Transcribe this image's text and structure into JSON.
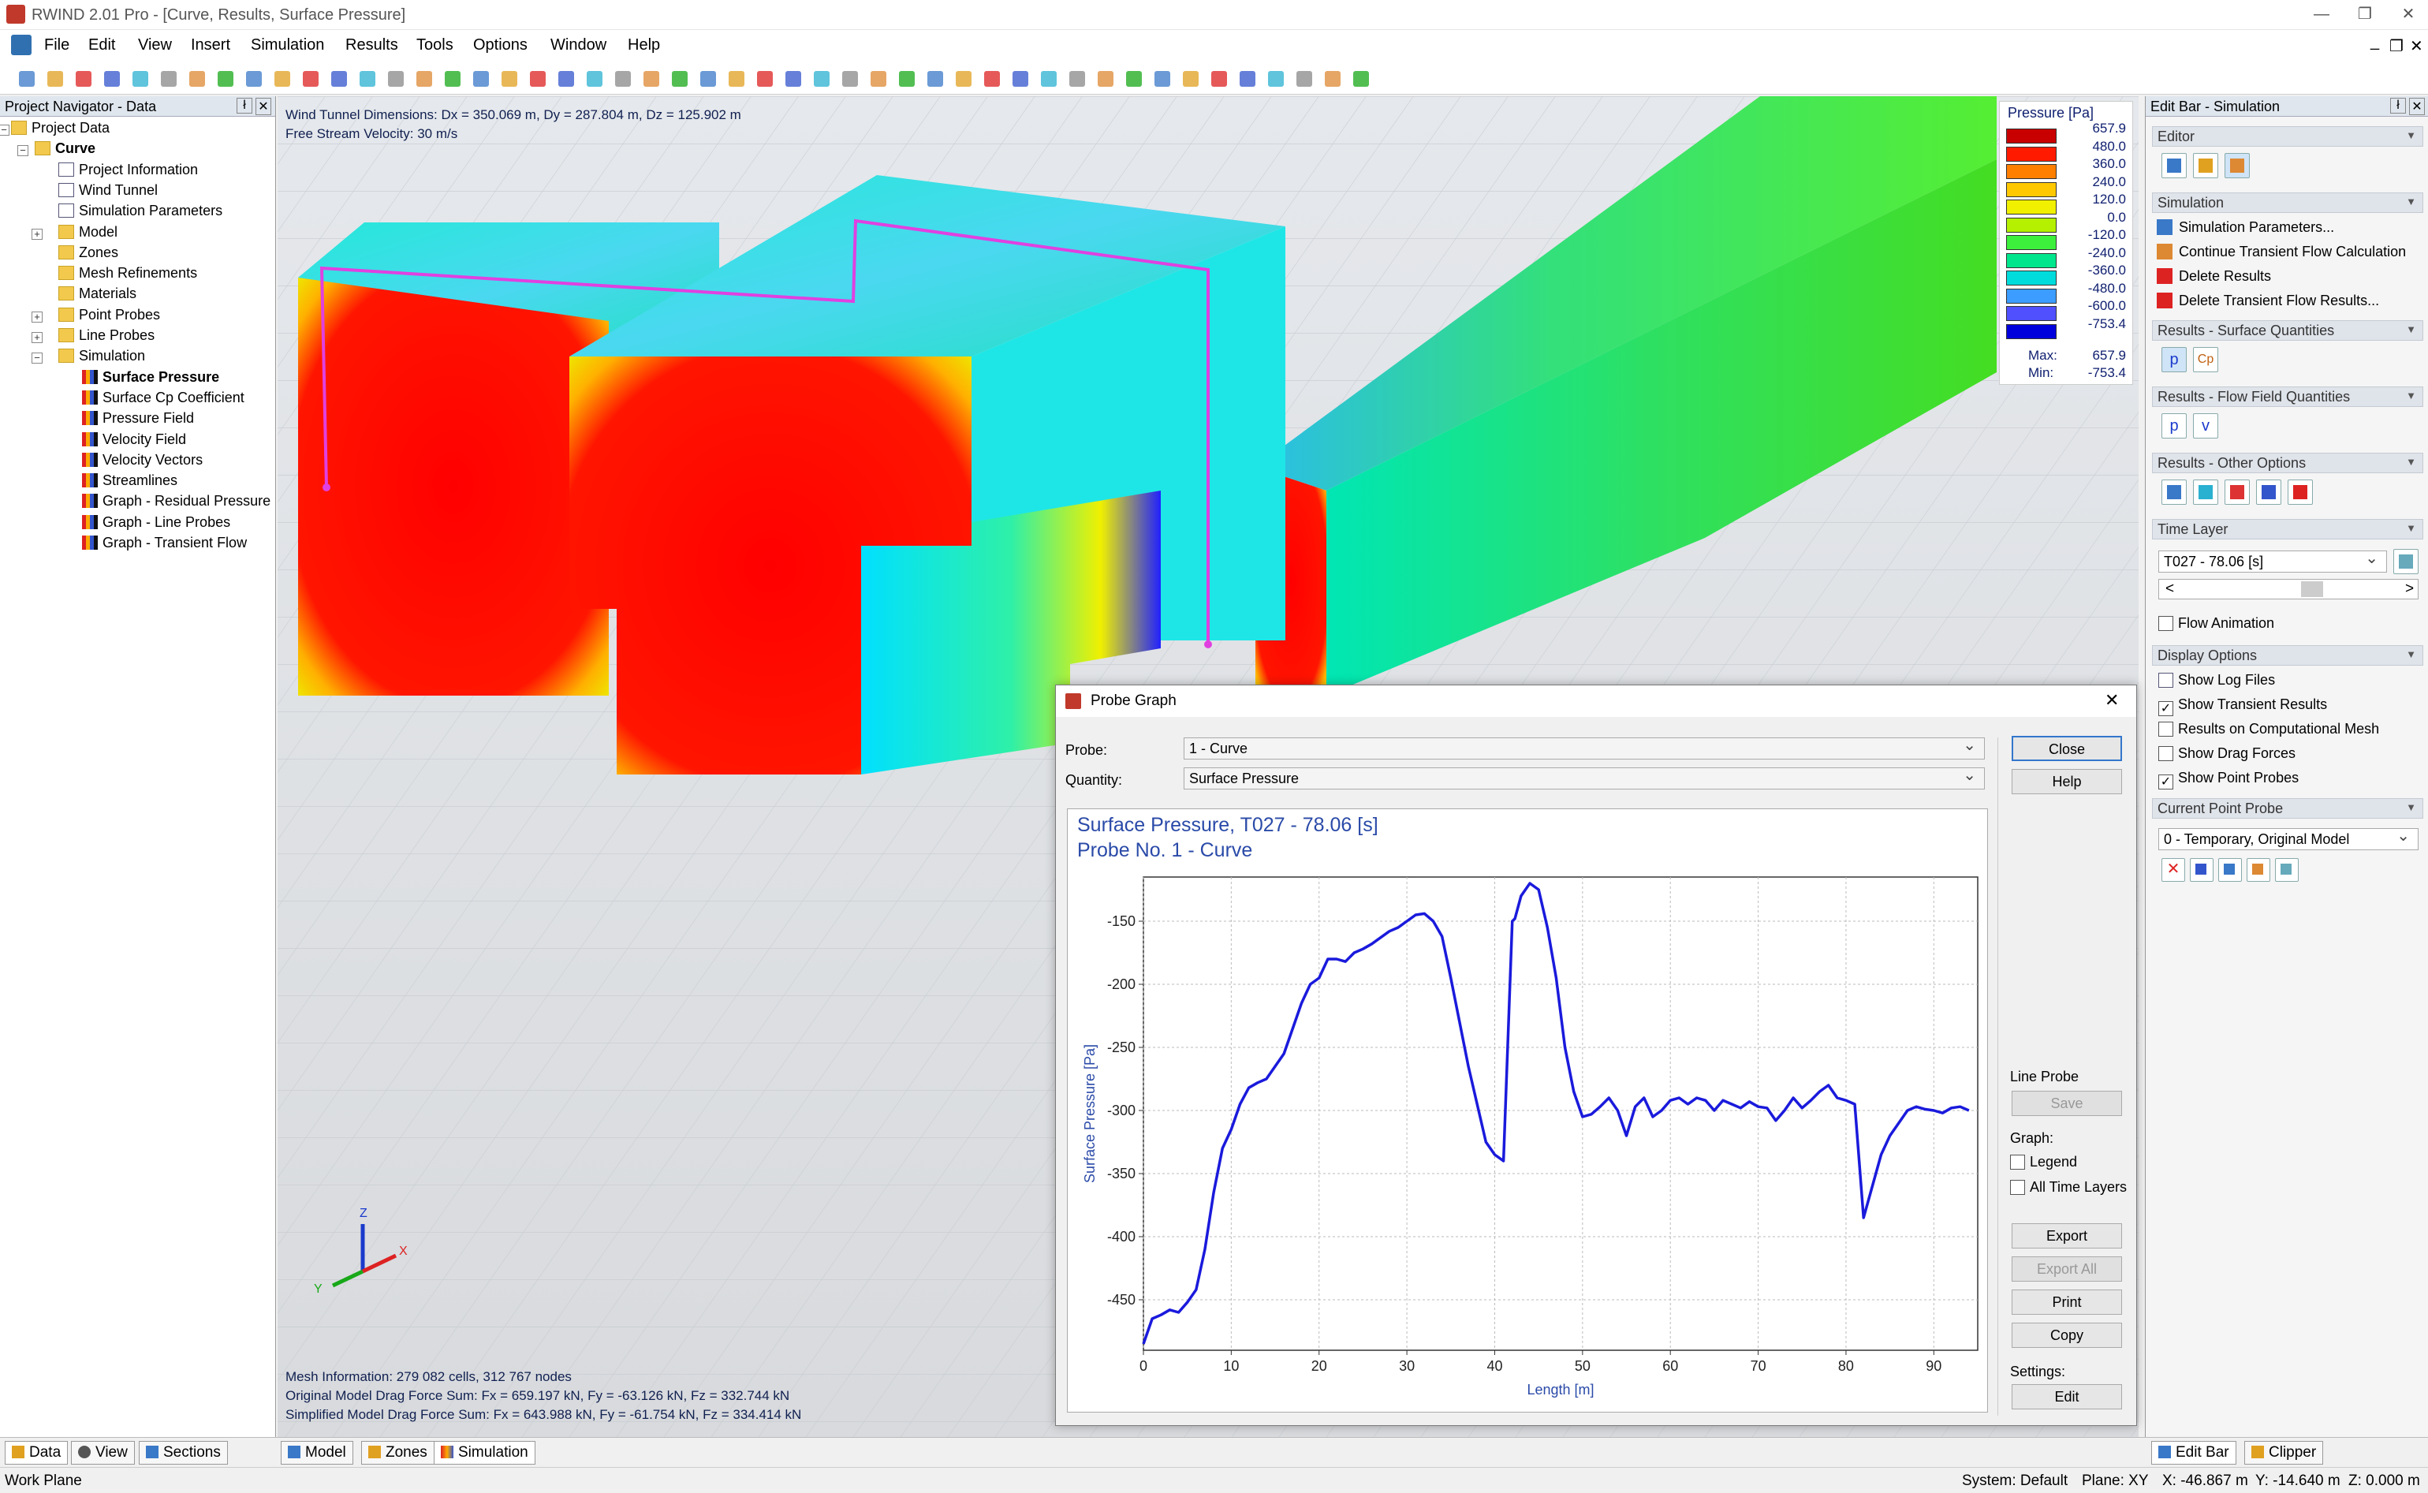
{
  "window": {
    "title": "RWIND 2.01 Pro - [Curve, Results, Surface Pressure]",
    "minimize": "—",
    "restore": "❐",
    "close": "✕",
    "inner_min": "_",
    "inner_restore": "❐",
    "inner_close": "✕"
  },
  "menu": [
    "File",
    "Edit",
    "View",
    "Insert",
    "Simulation",
    "Results",
    "Tools",
    "Options",
    "Window",
    "Help"
  ],
  "navigator": {
    "title": "Project Navigator - Data",
    "pin": "ł",
    "close": "✕",
    "items": [
      {
        "label": "Project Data",
        "icon": "folder"
      },
      {
        "label": "Curve",
        "icon": "folder",
        "bold": true
      },
      {
        "label": "Project Information",
        "icon": "doc"
      },
      {
        "label": "Wind Tunnel",
        "icon": "doc"
      },
      {
        "label": "Simulation Parameters",
        "icon": "doc"
      },
      {
        "label": "Model",
        "icon": "folder"
      },
      {
        "label": "Zones",
        "icon": "folder"
      },
      {
        "label": "Mesh Refinements",
        "icon": "folder"
      },
      {
        "label": "Materials",
        "icon": "folder"
      },
      {
        "label": "Point Probes",
        "icon": "folder"
      },
      {
        "label": "Line Probes",
        "icon": "folder"
      },
      {
        "label": "Simulation",
        "icon": "folder"
      },
      {
        "label": "Surface Pressure",
        "icon": "result",
        "bold": true
      },
      {
        "label": "Surface Cp Coefficient",
        "icon": "result"
      },
      {
        "label": "Pressure Field",
        "icon": "result"
      },
      {
        "label": "Velocity Field",
        "icon": "result"
      },
      {
        "label": "Velocity Vectors",
        "icon": "result"
      },
      {
        "label": "Streamlines",
        "icon": "result"
      },
      {
        "label": "Graph - Residual Pressure",
        "icon": "result"
      },
      {
        "label": "Graph - Line Probes",
        "icon": "result"
      },
      {
        "label": "Graph - Transient Flow",
        "icon": "result"
      }
    ],
    "tabs": [
      "Data",
      "View",
      "Sections"
    ]
  },
  "viewport": {
    "info1": "Wind Tunnel Dimensions: Dx = 350.069 m, Dy = 287.804 m, Dz = 125.902 m",
    "info2": "Free Stream Velocity: 30 m/s",
    "mesh": "Mesh Information: 279 082 cells, 312 767 nodes",
    "drag1": "Original Model Drag Force Sum: Fx = 659.197 kN, Fy = -63.126 kN, Fz = 332.744 kN",
    "drag2": "Simplified Model Drag Force Sum: Fx = 643.988 kN, Fy = -61.754 kN, Fz = 334.414 kN",
    "axis_z": "Z",
    "axis_x": "X",
    "axis_y": "Y",
    "tabs": [
      "Model",
      "Zones",
      "Simulation"
    ]
  },
  "legend": {
    "title": "Pressure [Pa]",
    "values": [
      "657.9",
      "480.0",
      "360.0",
      "240.0",
      "120.0",
      "0.0",
      "-120.0",
      "-240.0",
      "-360.0",
      "-480.0",
      "-600.0",
      "-753.4"
    ],
    "colors": [
      "#c80000",
      "#ff1a00",
      "#ff7f00",
      "#ffc800",
      "#f0f000",
      "#b4f000",
      "#3cf03c",
      "#00e68c",
      "#00dcdc",
      "#3c9cff",
      "#5050ff",
      "#0000dc"
    ],
    "max_label": "Max:",
    "max": "657.9",
    "min_label": "Min:",
    "min": "-753.4"
  },
  "editbar": {
    "title": "Edit Bar - Simulation",
    "pin": "ł",
    "close": "✕",
    "editor": "Editor",
    "simulation": "Simulation",
    "sim_items": [
      "Simulation Parameters...",
      "Continue Transient Flow Calculation",
      "Delete Results",
      "Delete Transient Flow Results..."
    ],
    "surface_q": "Results - Surface Quantities",
    "surface_icons": [
      "p",
      "Cp"
    ],
    "flow_q": "Results - Flow Field Quantities",
    "flow_icons": [
      "p",
      "v"
    ],
    "other": "Results - Other Options",
    "time_layer": "Time Layer",
    "time_value": "T027 - 78.06 [s]",
    "scroll_left": "<",
    "scroll_right": ">",
    "flow_animation": "Flow Animation",
    "display": "Display Options",
    "display_items": [
      {
        "label": "Show Log Files",
        "type": "icon"
      },
      {
        "label": "Show Transient Results",
        "checked": true
      },
      {
        "label": "Results on Computational Mesh",
        "checked": false
      },
      {
        "label": "Show Drag Forces",
        "checked": false
      },
      {
        "label": "Show Point Probes",
        "checked": true
      }
    ],
    "current_probe": "Current Point Probe",
    "probe_value": "0 - Temporary, Original Model",
    "tabs": [
      "Edit Bar",
      "Clipper"
    ]
  },
  "dialog": {
    "title": "Probe Graph",
    "close_x": "✕",
    "probe_label": "Probe:",
    "probe_value": "1 - Curve",
    "quantity_label": "Quantity:",
    "quantity_value": "Surface Pressure",
    "close": "Close",
    "help": "Help",
    "line_probe": "Line Probe",
    "save": "Save",
    "graph": "Graph:",
    "legend": "Legend",
    "all_time": "All Time Layers",
    "export": "Export",
    "export_all": "Export All",
    "print": "Print",
    "copy": "Copy",
    "settings": "Settings:",
    "edit": "Edit"
  },
  "chart_data": {
    "type": "line",
    "title": "Surface Pressure, T027 - 78.06 [s]",
    "subtitle": "Probe No. 1 - Curve",
    "xlabel": "Length [m]",
    "ylabel": "Surface Pressure [Pa]",
    "xlim": [
      0,
      95
    ],
    "ylim": [
      -490,
      -115
    ],
    "xticks": [
      0,
      10,
      20,
      30,
      40,
      50,
      60,
      70,
      80,
      90
    ],
    "yticks": [
      -150,
      -200,
      -250,
      -300,
      -350,
      -400,
      -450
    ],
    "grid": true,
    "color": "#1a1adc",
    "x": [
      0,
      1,
      2,
      3,
      4,
      5,
      6,
      7,
      8,
      9,
      10,
      11,
      12,
      13,
      14,
      15,
      16,
      17,
      18,
      19,
      20,
      21,
      22,
      23,
      24,
      25,
      26,
      27,
      28,
      29,
      30,
      31,
      32,
      33,
      34,
      35,
      36,
      37,
      38,
      39,
      40,
      41,
      42,
      42.3,
      43,
      44,
      45,
      46,
      47,
      48,
      49,
      50,
      51,
      52,
      53,
      54,
      55,
      56,
      57,
      58,
      59,
      60,
      61,
      62,
      63,
      64,
      65,
      66,
      67,
      68,
      69,
      70,
      71,
      72,
      73,
      74,
      75,
      76,
      77,
      78,
      79,
      80,
      81,
      82,
      83,
      84,
      85,
      86,
      87,
      88,
      89,
      90,
      91,
      92,
      93,
      94
    ],
    "y": [
      -485,
      -465,
      -462,
      -458,
      -460,
      -452,
      -442,
      -410,
      -365,
      -330,
      -315,
      -295,
      -282,
      -278,
      -275,
      -265,
      -255,
      -235,
      -215,
      -200,
      -195,
      -180,
      -180,
      -182,
      -175,
      -172,
      -168,
      -163,
      -158,
      -155,
      -150,
      -145,
      -144,
      -150,
      -162,
      -195,
      -230,
      -265,
      -295,
      -325,
      -335,
      -340,
      -150,
      -148,
      -130,
      -120,
      -125,
      -155,
      -195,
      -250,
      -285,
      -305,
      -303,
      -297,
      -290,
      -300,
      -320,
      -297,
      -290,
      -305,
      -300,
      -292,
      -290,
      -295,
      -290,
      -292,
      -300,
      -292,
      -295,
      -298,
      -293,
      -297,
      -298,
      -308,
      -300,
      -290,
      -298,
      -292,
      -285,
      -280,
      -290,
      -292,
      -295,
      -385,
      -360,
      -335,
      -320,
      -310,
      -300,
      -297,
      -299,
      -300,
      -302,
      -298,
      -297,
      -300
    ]
  }
}
